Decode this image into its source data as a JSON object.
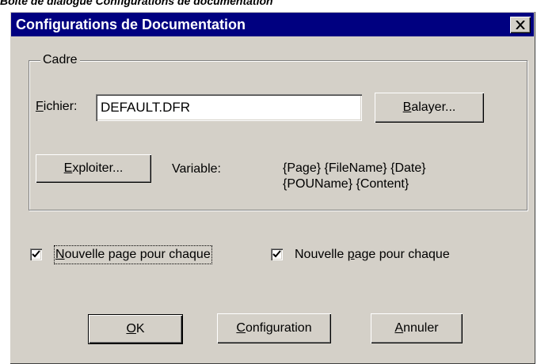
{
  "caption": "Boîte de dialogue Configurations de documentation",
  "window": {
    "title": "Configurations de Documentation",
    "close_icon": "close-icon"
  },
  "frame": {
    "label": "Cadre",
    "file_label": "Fichier:",
    "file_value": "DEFAULT.DFR",
    "browse_label": "Balayer...",
    "explore_label": "Exploiter...",
    "variable_label": "Variable:",
    "variables_line1": "{Page} {FileName} {Date}",
    "variables_line2": "{POUName} {Content}"
  },
  "options": {
    "checkbox1": {
      "label": "Nouvelle page pour chaque",
      "checked": true
    },
    "checkbox2": {
      "label": "Nouvelle page pour chaque",
      "checked": true
    }
  },
  "buttons": {
    "ok": "OK",
    "config": "Configuration",
    "cancel": "Annuler"
  }
}
